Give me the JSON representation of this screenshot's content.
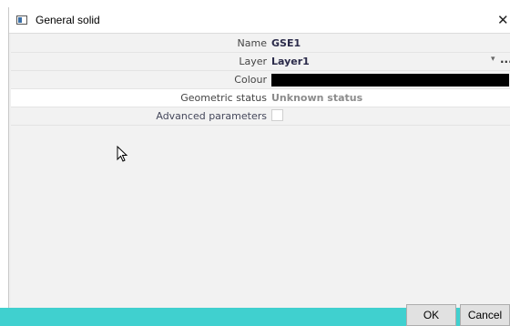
{
  "window": {
    "title": "General solid"
  },
  "properties": [
    {
      "label": "Name",
      "value": "GSE1"
    },
    {
      "label": "Layer",
      "value": "Layer1"
    },
    {
      "label": "Colour",
      "value": "",
      "swatch_color": "#000000"
    },
    {
      "label": "Geometric status",
      "value": "Unknown status"
    },
    {
      "label": "Advanced parameters",
      "value": "",
      "checked": false
    }
  ],
  "layer_more": "...",
  "buttons": {
    "ok": "OK",
    "cancel": "Cancel"
  },
  "colors": {
    "footer_accent": "#40d0cf"
  }
}
